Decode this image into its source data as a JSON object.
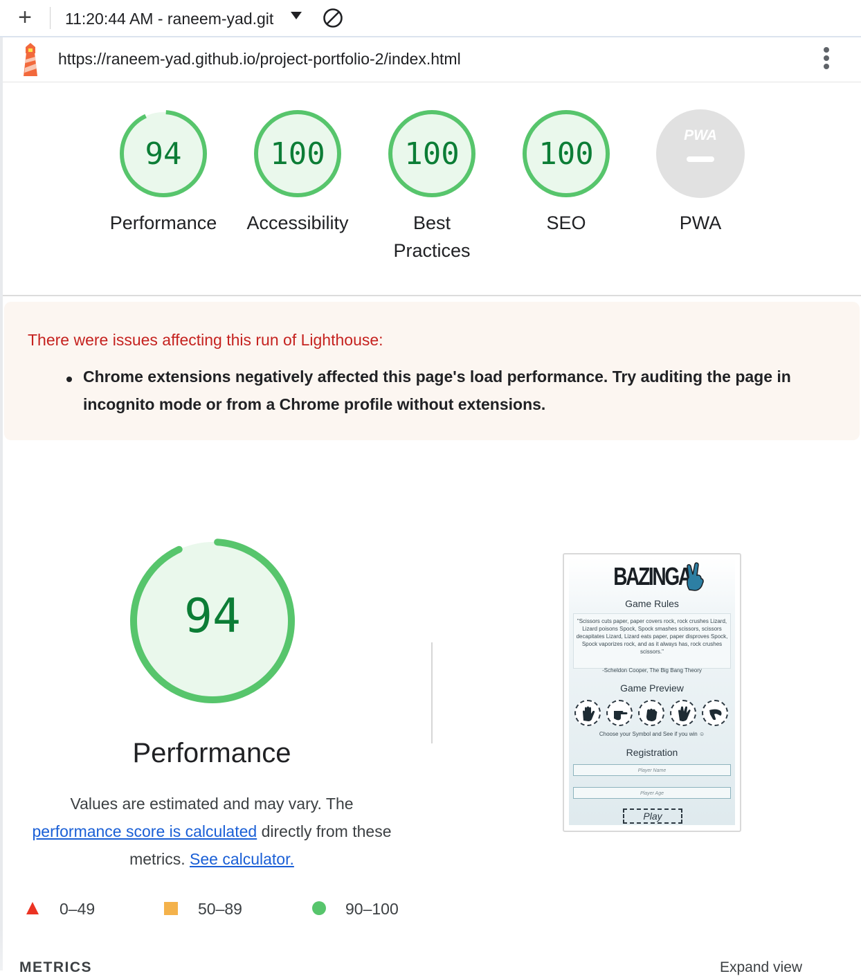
{
  "toolbar": {
    "report_title": "11:20:44 AM - raneem-yad.git",
    "new_report_icon": "plus-icon",
    "dropdown_icon": "caret-down-icon",
    "clear_icon": "block-icon"
  },
  "urlbar": {
    "url": "https://raneem-yad.github.io/project-portfolio-2/index.html",
    "menu_icon": "kebab-icon"
  },
  "categories": [
    {
      "label": "Performance",
      "score": 94,
      "score_text": "94",
      "status": "pass"
    },
    {
      "label": "Accessibility",
      "score": 100,
      "score_text": "100",
      "status": "pass"
    },
    {
      "label": "Best\nPractices",
      "score": 100,
      "score_text": "100",
      "status": "pass"
    },
    {
      "label": "SEO",
      "score": 100,
      "score_text": "100",
      "status": "pass"
    },
    {
      "label": "PWA",
      "badge_text": "PWA",
      "status": "na"
    }
  ],
  "warning": {
    "title": "There were issues affecting this run of Lighthouse:",
    "items": [
      "Chrome extensions negatively affected this page's load performance. Try auditing the page in incognito mode or from a Chrome profile without extensions."
    ]
  },
  "performance": {
    "score": 94,
    "score_text": "94",
    "title": "Performance",
    "desc_1": "Values are estimated and may vary. The",
    "link_1": "performance score is calculated",
    "desc_2": " directly from these metrics. ",
    "link_2": "See calculator."
  },
  "legend": [
    {
      "icon": "triangle-red",
      "range": "0–49"
    },
    {
      "icon": "square-orange",
      "range": "50–89"
    },
    {
      "icon": "circle-green",
      "range": "90–100"
    }
  ],
  "screenshot": {
    "logo": "BAZINGA",
    "logo_icon": "peace-hand-icon",
    "rules_heading": "Game Rules",
    "quote": "\"Scissors cuts paper, paper covers rock, rock crushes Lizard, Lizard poisons Spock, Spock smashes scissors, scissors decapitates Lizard, Lizard eats paper, paper disproves Spock, Spock vaporizes rock, and as it always has, rock crushes scissors.\"",
    "quote_author": "-Scheldon Cooper, The Big Bang Theory",
    "preview_heading": "Game Preview",
    "hands": [
      "paper-hand-icon",
      "scissors-hand-icon",
      "rock-hand-icon",
      "spock-hand-icon",
      "lizard-hand-icon"
    ],
    "hint": "Choose your Symbol and See if you win ☺",
    "registration_heading": "Registration",
    "name_placeholder": "Player Name",
    "age_placeholder": "Player Age",
    "play_label": "Play"
  },
  "bottom": {
    "metrics_heading": "METRICS",
    "expand_label": "Expand view"
  },
  "colors": {
    "pass": "#0c7d36",
    "pass_ring": "#57c56c",
    "pass_fill": "#eaf8ec",
    "na": "#e1e1e1",
    "warning_text": "#c5221f",
    "link": "#1a5fd6"
  }
}
